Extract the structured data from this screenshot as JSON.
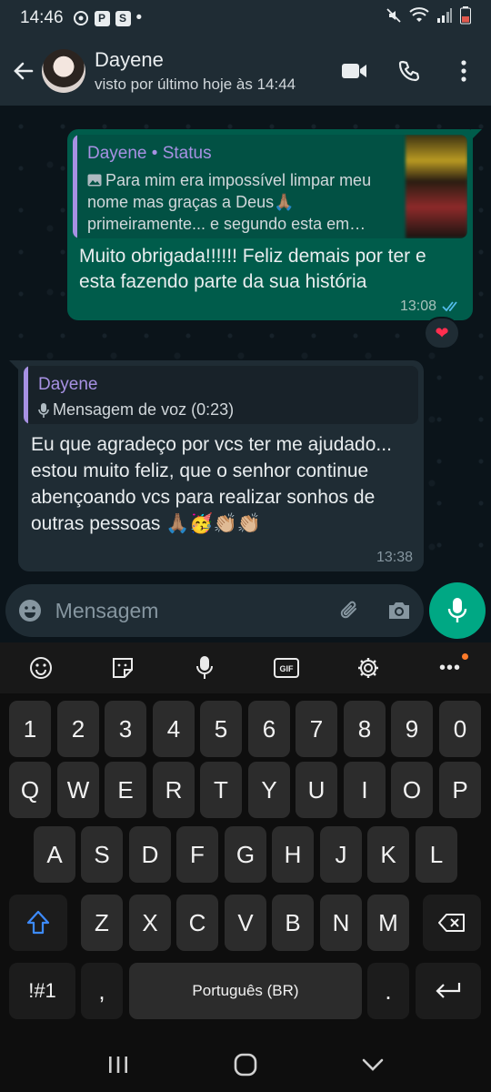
{
  "status_bar": {
    "time": "14:46",
    "p_badge": "P",
    "s_badge": "S",
    "dot": "•"
  },
  "header": {
    "contact_name": "Dayene",
    "last_seen": "visto por último hoje às 14:44"
  },
  "messages": [
    {
      "direction": "outgoing",
      "quote_title": "Dayene • Status",
      "quote_text": "Para mim era impossível limpar meu nome mas graças a Deus🙏🏽 primeiramente... e segundo esta em…",
      "text": "Muito obrigada!!!!!! Feliz demais por ter e esta fazendo parte da sua história",
      "time": "13:08",
      "reaction": "❤"
    },
    {
      "direction": "incoming",
      "quote_title": "Dayene",
      "quote_text": "Mensagem de voz (0:23)",
      "text": "Eu que agradeço por vcs ter me ajudado... estou muito feliz, que o senhor continue abençoando vcs para realizar sonhos de outras pessoas 🙏🏽🥳👏🏼👏🏼",
      "time": "13:38"
    }
  ],
  "composer": {
    "placeholder": "Mensagem"
  },
  "keyboard": {
    "toolbar": [
      "emoji-icon",
      "sticker-icon",
      "voice-icon",
      "gif-icon",
      "settings-icon",
      "more-icon"
    ],
    "gif_label": "GIF",
    "more_label": "•••",
    "row_numbers": [
      "1",
      "2",
      "3",
      "4",
      "5",
      "6",
      "7",
      "8",
      "9",
      "0"
    ],
    "row_top": [
      "Q",
      "W",
      "E",
      "R",
      "T",
      "Y",
      "U",
      "I",
      "O",
      "P"
    ],
    "row_mid": [
      "A",
      "S",
      "D",
      "F",
      "G",
      "H",
      "J",
      "K",
      "L"
    ],
    "row_bottom": [
      "Z",
      "X",
      "C",
      "V",
      "B",
      "N",
      "M"
    ],
    "symbols_label": "!#1",
    "comma_label": ",",
    "space_label": "Português (BR)",
    "period_label": "."
  },
  "colors": {
    "accent": "#00a884",
    "outgoing_bubble": "#005c4b",
    "incoming_bubble": "#1f2c34",
    "quote_author": "#a791e3"
  }
}
